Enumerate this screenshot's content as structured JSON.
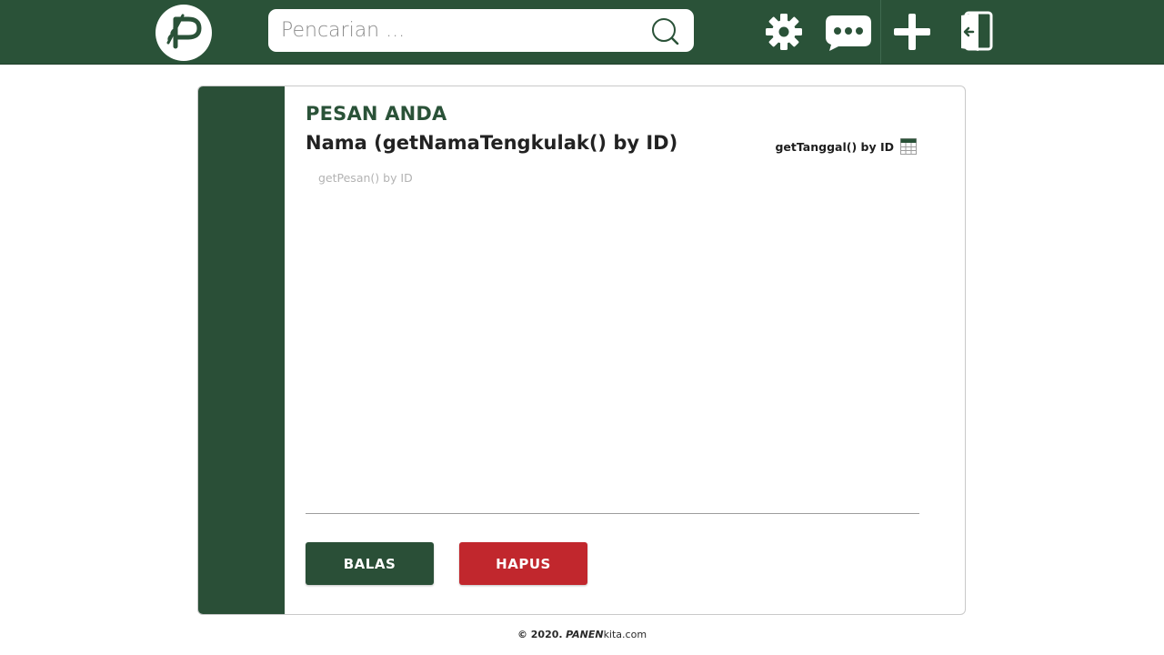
{
  "header": {
    "logo_icon": "brand-logo-icon",
    "search": {
      "placeholder": "Pencarian ...",
      "value": "",
      "icon": "search-icon"
    },
    "actions": [
      {
        "icon": "gear-icon",
        "label": "Settings"
      },
      {
        "icon": "chat-bubble-icon",
        "label": "Messages"
      },
      {
        "icon": "plus-icon",
        "label": "Add"
      },
      {
        "icon": "logout-icon",
        "label": "Logout"
      }
    ]
  },
  "message": {
    "heading": "PESAN ANDA",
    "sender": "Nama (getNamaTengkulak() by ID)",
    "date": "getTanggal() by ID",
    "date_icon": "calendar-icon",
    "body": "getPesan() by ID"
  },
  "buttons": {
    "reply": "BALAS",
    "delete": "HAPUS"
  },
  "footer": {
    "copyright": "© 2020.",
    "brand_bold": "PANEN",
    "brand_rest": "kita.com"
  },
  "colors": {
    "primary": "#2a5238",
    "sidebar": "#2a4f37",
    "danger": "#c1272d",
    "background": "#ffffff"
  }
}
